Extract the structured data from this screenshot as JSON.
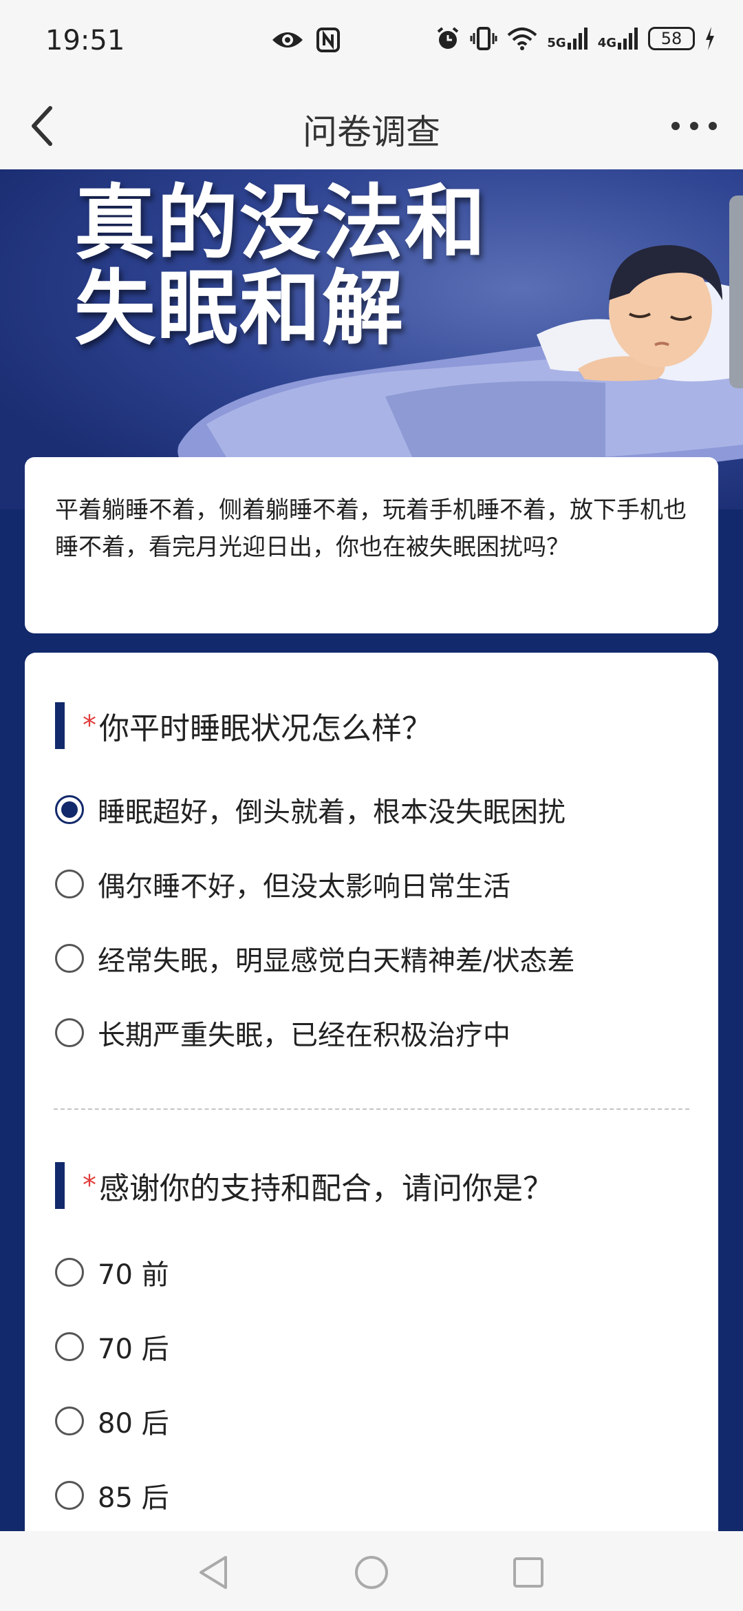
{
  "status_bar": {
    "time": "19:51",
    "network_1": "5G",
    "network_2": "4G",
    "battery": "58",
    "icons": [
      "eye-icon",
      "nfc-icon",
      "alarm-icon",
      "vibrate-icon",
      "wifi-icon",
      "signal-icon",
      "charging-icon"
    ]
  },
  "nav": {
    "title": "问卷调查",
    "back_icon": "chevron-left-icon",
    "more_icon": "more-dots-icon"
  },
  "banner": {
    "line1": "真的没法和",
    "line2": "失眠和解"
  },
  "intro": {
    "text": "平着躺睡不着，侧着躺睡不着，玩着手机睡不着，放下手机也睡不着，看完月光迎日出，你也在被失眠困扰吗？"
  },
  "questions": [
    {
      "required_mark": "*",
      "title": "你平时睡眠状况怎么样？",
      "options": [
        {
          "label": "睡眠超好，倒头就着，根本没失眠困扰",
          "selected": true
        },
        {
          "label": "偶尔睡不好，但没太影响日常生活",
          "selected": false
        },
        {
          "label": "经常失眠，明显感觉白天精神差/状态差",
          "selected": false
        },
        {
          "label": "长期严重失眠，已经在积极治疗中",
          "selected": false
        }
      ]
    },
    {
      "required_mark": "*",
      "title": "感谢你的支持和配合，请问你是？",
      "options": [
        {
          "label": "70 前",
          "selected": false
        },
        {
          "label": "70 后",
          "selected": false
        },
        {
          "label": "80 后",
          "selected": false
        },
        {
          "label": "85 后",
          "selected": false
        }
      ]
    }
  ],
  "colors": {
    "accent": "#12296b",
    "required": "#e23c3c",
    "card": "#ffffff",
    "bar_bg": "#f6f6f6"
  },
  "system_nav": {
    "icons": [
      "back-triangle-icon",
      "home-circle-icon",
      "recents-square-icon"
    ]
  }
}
